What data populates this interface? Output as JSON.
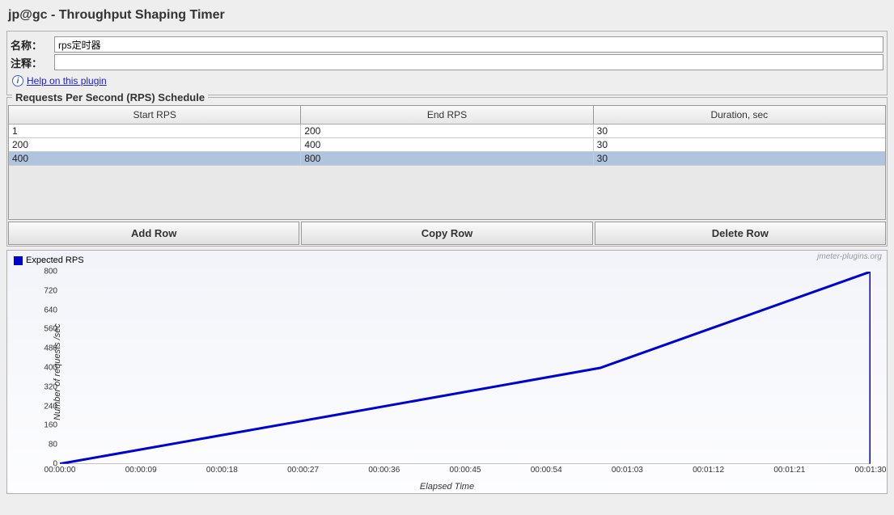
{
  "title": "jp@gc - Throughput Shaping Timer",
  "form": {
    "name_label": "名称：",
    "name_value": "rps定时器",
    "comment_label": "注释：",
    "comment_value": ""
  },
  "help": {
    "link_text": "Help on this plugin"
  },
  "schedule": {
    "group_title": "Requests Per Second (RPS) Schedule",
    "columns": [
      "Start RPS",
      "End RPS",
      "Duration, sec"
    ],
    "rows": [
      {
        "start": "1",
        "end": "200",
        "duration": "30",
        "selected": false
      },
      {
        "start": "200",
        "end": "400",
        "duration": "30",
        "selected": false
      },
      {
        "start": "400",
        "end": "800",
        "duration": "30",
        "selected": true
      }
    ]
  },
  "buttons": {
    "add": "Add Row",
    "copy": "Copy Row",
    "delete": "Delete Row"
  },
  "chart_data": {
    "type": "line",
    "title": "",
    "legend": [
      "Expected RPS"
    ],
    "xlabel": "Elapsed Time",
    "ylabel": "Number of requests /sec",
    "watermark": "jmeter-plugins.org",
    "ylim": [
      0,
      800
    ],
    "y_ticks": [
      0,
      80,
      160,
      240,
      320,
      400,
      480,
      560,
      640,
      720,
      800
    ],
    "x_ticks": [
      "00:00:00",
      "00:00:09",
      "00:00:18",
      "00:00:27",
      "00:00:36",
      "00:00:45",
      "00:00:54",
      "00:01:03",
      "00:01:12",
      "00:01:21",
      "00:01:30"
    ],
    "series": [
      {
        "name": "Expected RPS",
        "color": "#0000cc",
        "points": [
          {
            "t": 0,
            "v": 1
          },
          {
            "t": 30,
            "v": 200
          },
          {
            "t": 30,
            "v": 200
          },
          {
            "t": 60,
            "v": 400
          },
          {
            "t": 60,
            "v": 400
          },
          {
            "t": 90,
            "v": 800
          },
          {
            "t": 90,
            "v": 0
          }
        ]
      }
    ],
    "xlim": [
      0,
      90
    ]
  }
}
